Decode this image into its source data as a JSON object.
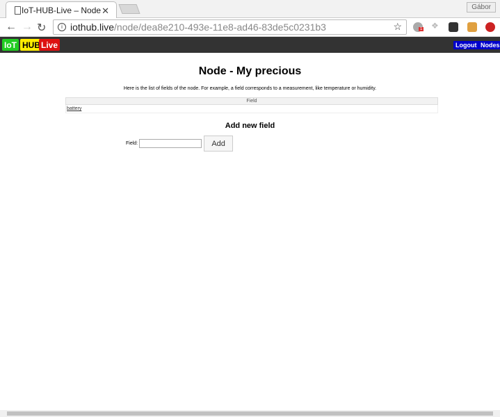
{
  "browser": {
    "tab_title": "IoT-HUB-Live – Node",
    "user": "Gábor",
    "url_host": "iothub.live",
    "url_path": "/node/dea8e210-493e-11e8-ad46-83de5c0231b3",
    "ext_badge": "1"
  },
  "nav": {
    "logo": [
      "IoT",
      "HUB",
      "Live"
    ],
    "logout": "Logout",
    "nodes": "Nodes"
  },
  "main": {
    "title": "Node - My precious",
    "description": "Here is the list of fields of the node. For example, a field corresponds to a measurement, like temperature or humidity.",
    "table": {
      "header": "Field",
      "rows": [
        "battery"
      ]
    },
    "add_title": "Add new field",
    "field_label": "Field:",
    "field_value": "",
    "add_button": "Add"
  },
  "colors": {
    "iot": "#22cc22",
    "hub": "#ffee00",
    "live": "#dd1111",
    "nav_button": "#0000cc"
  }
}
